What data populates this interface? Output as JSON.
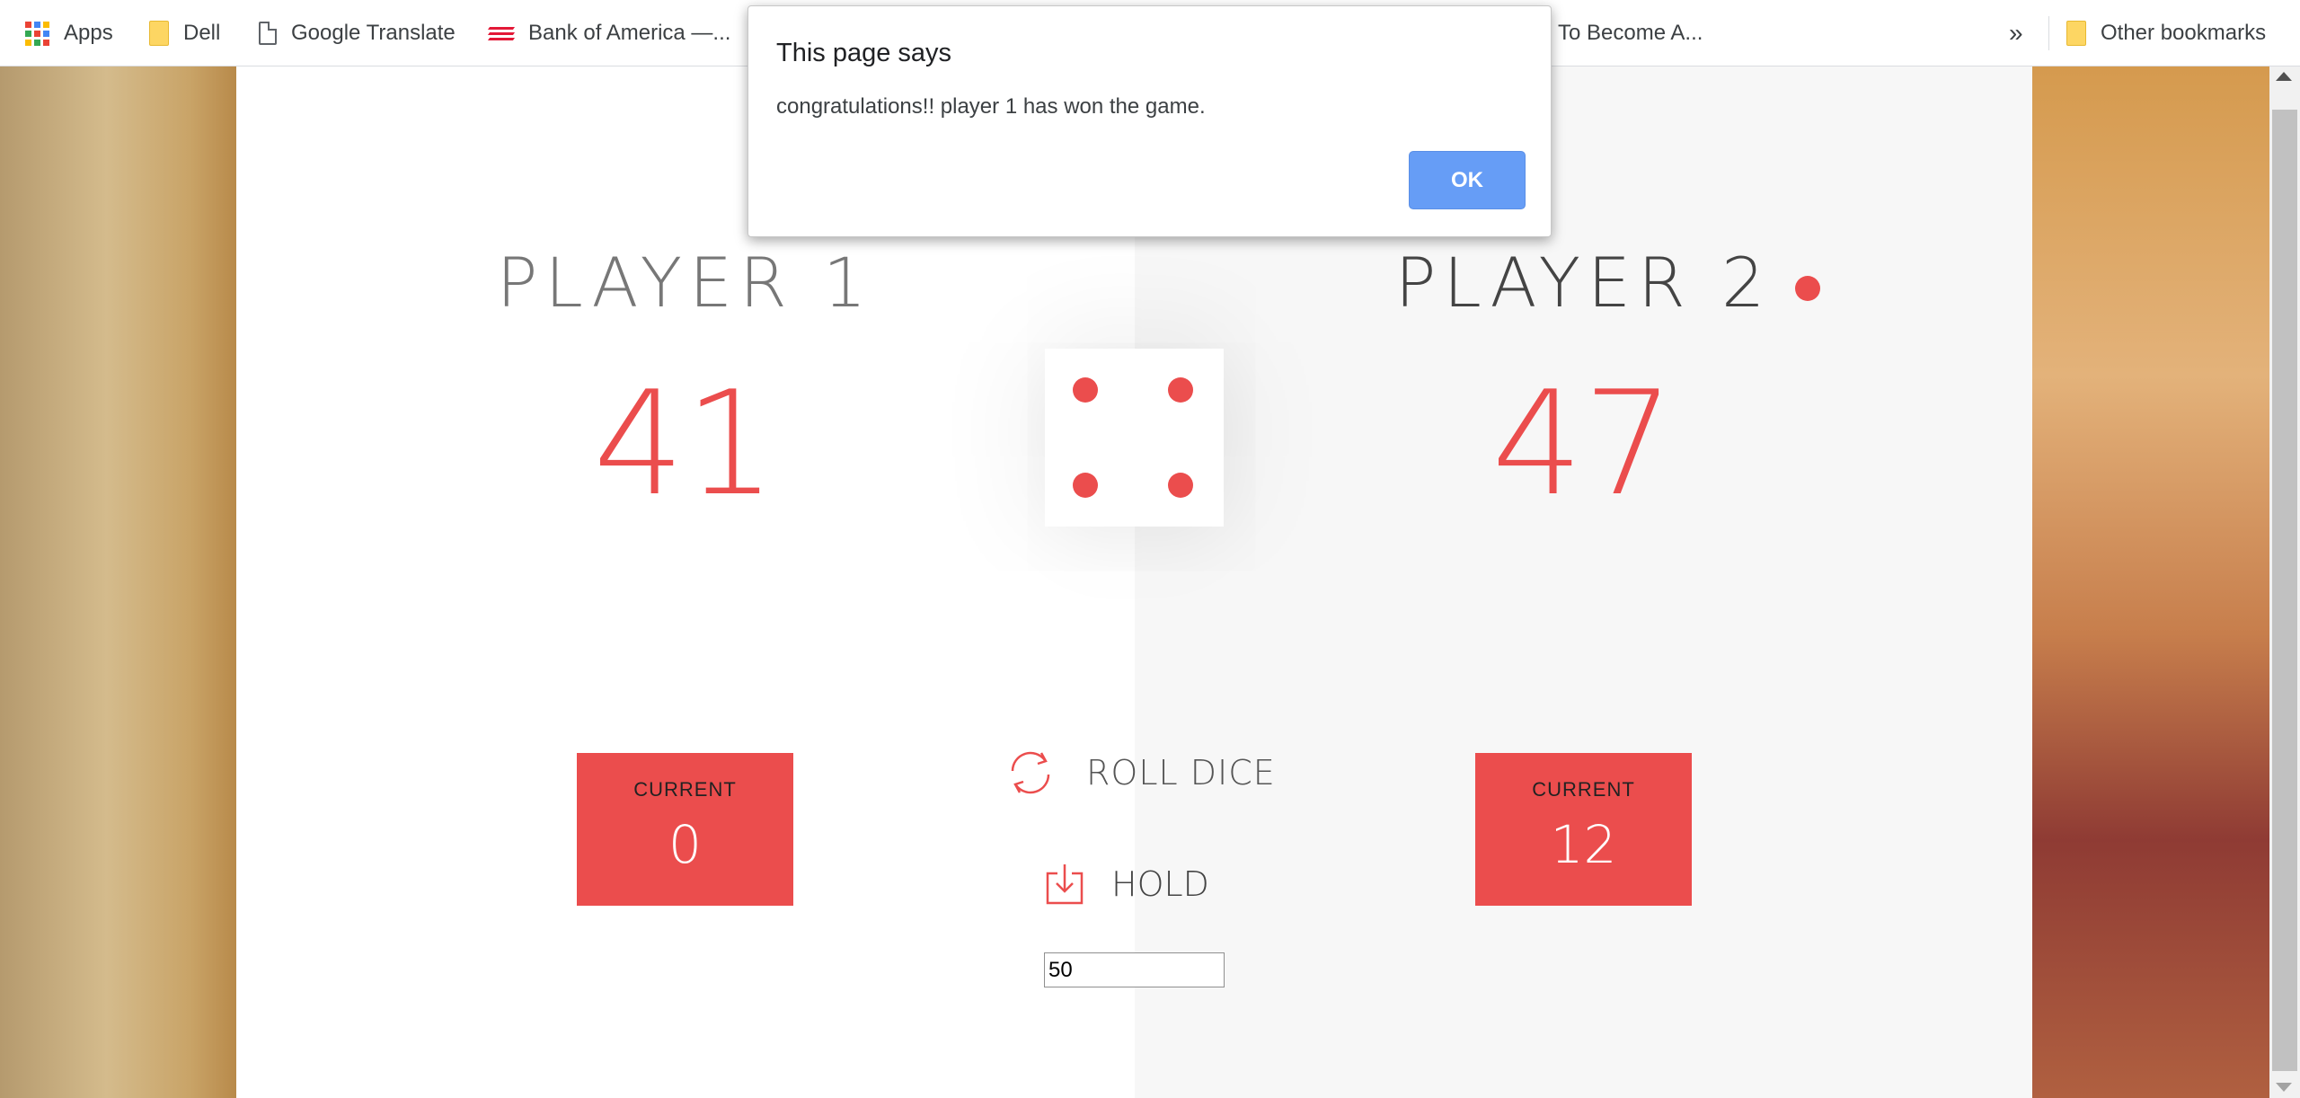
{
  "bookmarks": {
    "items": [
      {
        "label": "Apps",
        "icon": "apps-grid-icon"
      },
      {
        "label": "Dell",
        "icon": "folder-icon"
      },
      {
        "label": "Google Translate",
        "icon": "page-icon"
      },
      {
        "label": "Bank of America —...",
        "icon": "bank-of-america-icon"
      },
      {
        "label": "To Become A..."
      }
    ],
    "more": "»",
    "other": "Other bookmarks"
  },
  "game": {
    "player1": {
      "name": "PLAYER 1",
      "score": "41",
      "current_label": "CURRENT",
      "current": "0"
    },
    "player2": {
      "name": "PLAYER 2",
      "score": "47",
      "current_label": "CURRENT",
      "current": "12",
      "active": true
    },
    "dice_value": 4,
    "roll_label": "ROLL DICE",
    "hold_label": "HOLD",
    "target_score": "50"
  },
  "dialog": {
    "title": "This page says",
    "message": "congratulations!! player 1 has won the game.",
    "ok_label": "OK"
  },
  "colors": {
    "accent": "#eb4d4d",
    "dialog_button": "#669df6"
  }
}
